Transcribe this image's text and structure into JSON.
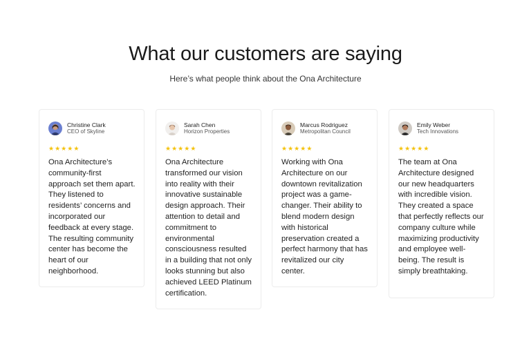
{
  "header": {
    "title": "What our customers are saying",
    "subtitle": "Here’s what people think about the Ona Architecture"
  },
  "colors": {
    "star": "#f4c20d",
    "card_border": "#ececec",
    "text": "#222222"
  },
  "testimonials": [
    {
      "name": "Christine Clark",
      "role": "CEO of Skyline",
      "rating": 5,
      "avatar_icon": "avatar-christine-icon",
      "quote": "Ona Architecture’s community-first approach set them apart. They listened to residents’ concerns and incorporated our feedback at every stage. The resulting community center has become the heart of our neighborhood."
    },
    {
      "name": "Sarah Chen",
      "role": "Horizon Properties",
      "rating": 5,
      "avatar_icon": "avatar-sarah-icon",
      "quote": "Ona Architecture transformed our vision into reality with their innovative sustainable design approach. Their attention to detail and commitment to environmental consciousness resulted in a building that not only looks stunning but also achieved LEED Platinum certification."
    },
    {
      "name": "Marcus Rodriguez",
      "role": "Metropolitan Council",
      "rating": 5,
      "avatar_icon": "avatar-marcus-icon",
      "quote": "Working with Ona Architecture on our downtown revitalization project was a game-changer. Their ability to blend modern design with historical preservation created a perfect harmony that has revitalized our city center."
    },
    {
      "name": "Emily Weber",
      "role": "Tech Innovations",
      "rating": 5,
      "avatar_icon": "avatar-emily-icon",
      "quote": "The team at Ona Architecture designed our new headquarters with incredible vision. They created a space that perfectly reflects our company culture while maximizing productivity and employee well-being. The result is simply breathtaking."
    }
  ]
}
